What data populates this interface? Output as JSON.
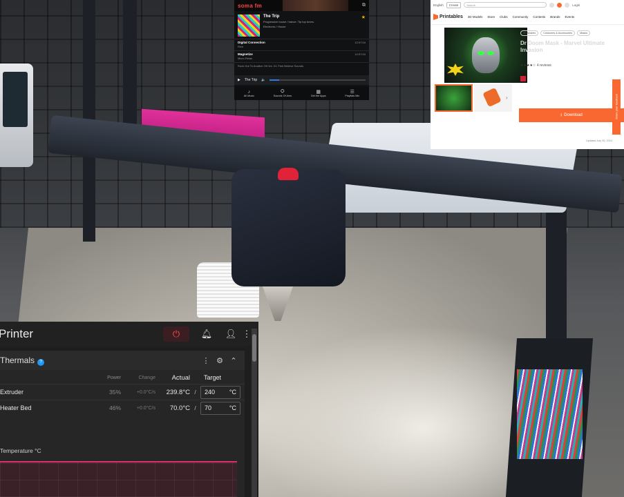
{
  "music_widget": {
    "logo": "soma fm",
    "now_playing": {
      "title": "The Trip",
      "subtitle": "Progressive house / trance. Tip top tunes.",
      "detail": "Electronic / House"
    },
    "tracks": [
      {
        "title": "Digital Connection",
        "artist": "Rich",
        "time": "12:07:04"
      },
      {
        "title": "Magnetize",
        "artist": "Micro Relax",
        "time": "12:07:04"
      }
    ],
    "last_line": "Rock Out To Another Hit Vol. 01: Feel Believe Sounds",
    "player_station": "The Trip",
    "progress": 0.1,
    "nav": [
      {
        "icon": "♪",
        "label": "All Music"
      },
      {
        "icon": "⛭",
        "label": "Sounds Of Ams"
      },
      {
        "icon": "▦",
        "label": "Get the Apps"
      },
      {
        "icon": "☰",
        "label": "Playlists Mix"
      }
    ]
  },
  "printables": {
    "top": {
      "language": "English",
      "create": "Create",
      "search_placeholder": "Search",
      "login": "Login"
    },
    "nav": {
      "brand": "Printables",
      "links": [
        "3D Models",
        "Store",
        "Clubs",
        "Community",
        "Contests",
        "Brands",
        "Events"
      ]
    },
    "tags": [
      "3D Models",
      "Costumes & Accessories",
      "Masks"
    ],
    "title": "Dr Doom Mask - Marvel Ultimate Invasion",
    "rating": "4 reviews",
    "download": "Download",
    "feedback": "Share your feedback",
    "updated": "Updated July 30, 2024"
  },
  "printer_ui": {
    "title": "Printer",
    "panel": "Thermals",
    "columns": {
      "power": "Power",
      "change": "Change",
      "actual": "Actual",
      "target": "Target"
    },
    "rows": [
      {
        "name": "Extruder",
        "power": "35%",
        "change": "+0.0°C/s",
        "actual": "239.8°C",
        "target": "240",
        "unit": "°C"
      },
      {
        "name": "Heater Bed",
        "power": "46%",
        "change": "+0.0°C/s",
        "actual": "70.0°C",
        "target": "70",
        "unit": "°C"
      }
    ],
    "chart_label": "Temperature °C"
  }
}
